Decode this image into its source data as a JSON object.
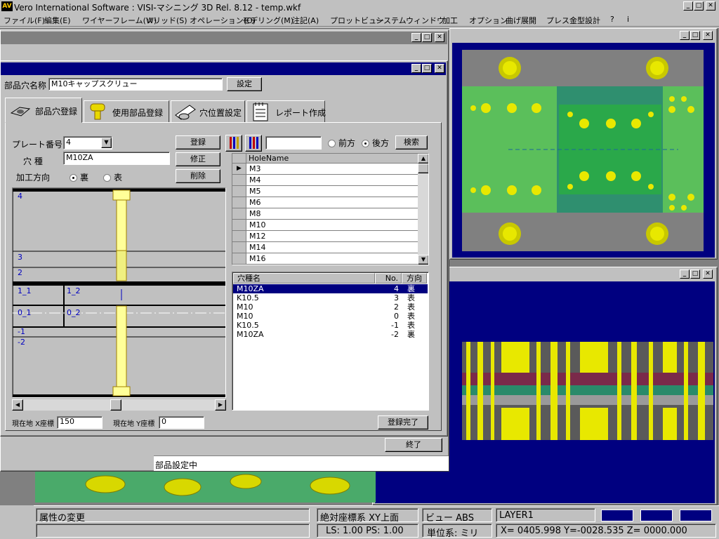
{
  "app": {
    "title": "Vero International Software : VISI-マシニング 3D Rel. 8.12 - temp.wkf",
    "logo": "AV"
  },
  "menu": [
    "ファイル(F)",
    "編集(E)",
    "ワイヤーフレーム(W)",
    "ソリッド(S)",
    "オペレーション(O)",
    "モデリング(M)",
    "注記(A)",
    "プロットビュー",
    "システム",
    "ウィンドウ",
    "加工",
    "オプション",
    "曲げ展開",
    "プレス金型設計",
    "?",
    "i"
  ],
  "dialog": {
    "hole_name_label": "部品穴名称",
    "hole_name_value": "M10キャップスクリュー",
    "set_button": "設定",
    "tabs": [
      "部品穴登録",
      "使用部品登録",
      "穴位置設定",
      "レポート作成"
    ],
    "plate_label": "プレート番号",
    "plate_value": "4",
    "kind_label": "穴 種",
    "kind_value": "M10ZA",
    "dir_label": "加工方向",
    "dir_back": "裏",
    "dir_front": "表",
    "register_btn": "登録",
    "modify_btn": "修正",
    "delete_btn": "削除",
    "diagram_labels": {
      "p4": "4",
      "p3": "3",
      "p2": "2",
      "p1_1": "1_1",
      "p1_2": "1_2",
      "p0_1": "0_1",
      "p0_2": "0_2",
      "m1": "-1",
      "m2": "-2"
    },
    "search_front": "前方",
    "search_back": "後方",
    "search_btn": "検索",
    "hole_header": "HoleName",
    "holes": [
      "M3",
      "M4",
      "M5",
      "M6",
      "M8",
      "M10",
      "M12",
      "M14",
      "M16"
    ],
    "list_headers": [
      "穴種名",
      "No.",
      "方向"
    ],
    "entries": [
      {
        "name": "M10ZA",
        "no": "4",
        "dir": "裏"
      },
      {
        "name": "K10.5",
        "no": "3",
        "dir": "表"
      },
      {
        "name": "M10",
        "no": "2",
        "dir": "表"
      },
      {
        "name": "M10",
        "no": "0",
        "dir": "表"
      },
      {
        "name": "K10.5",
        "no": "-1",
        "dir": "表"
      },
      {
        "name": "M10ZA",
        "no": "-2",
        "dir": "裏"
      }
    ],
    "x_label": "現在地 X座標",
    "x_value": "150",
    "y_label": "現在地 Y座標",
    "y_value": "0",
    "complete_btn": "登録完了",
    "end_btn": "終了"
  },
  "status": {
    "message": "部品設定中",
    "attr": "属性の変更",
    "coord_sys": "絶対座標系 XY上面",
    "view": "ビュー ABS",
    "layer": "LAYER1",
    "ls_ps": "LS: 1.00 PS: 1.00",
    "unit": "単位系: ミリ",
    "xyz": "X= 0405.998 Y=-0028.535 Z= 0000.000"
  }
}
